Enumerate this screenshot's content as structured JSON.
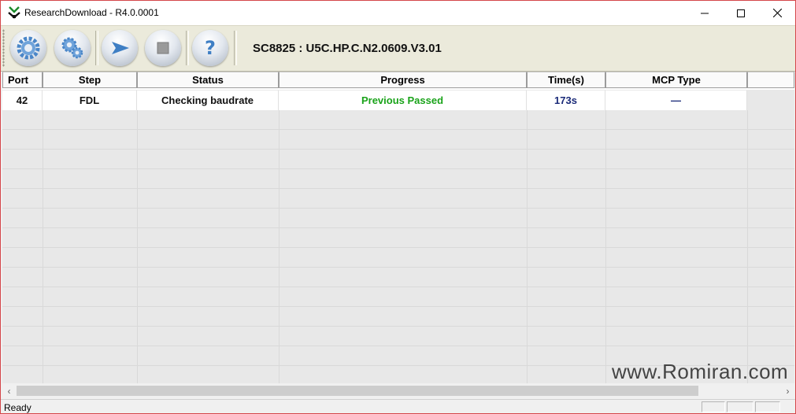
{
  "window": {
    "title": "ResearchDownload - R4.0.0001",
    "border_color": "#d4474a"
  },
  "toolbar": {
    "buttons": [
      {
        "icon": "load-packet-gear-icon"
      },
      {
        "icon": "settings-gears-icon"
      },
      {
        "icon": "start-download-arrow-icon"
      },
      {
        "icon": "stop-download-square-icon"
      },
      {
        "icon": "help-question-icon"
      }
    ],
    "info": "SC8825 : U5C.HP.C.N2.0609.V3.01",
    "background": "#ebeadb"
  },
  "grid": {
    "columns": [
      "Port",
      "Step",
      "Status",
      "Progress",
      "Time(s)",
      "MCP Type"
    ],
    "rows": [
      {
        "port": "42",
        "step": "FDL",
        "status": "Checking baudrate",
        "progress": "Previous Passed",
        "time": "173s",
        "mcp_type": "—"
      }
    ],
    "colors": {
      "progress": "#1aa31a",
      "time": "#1a2a78"
    }
  },
  "watermark": "www.Romiran.com",
  "statusbar": {
    "text": "Ready"
  }
}
